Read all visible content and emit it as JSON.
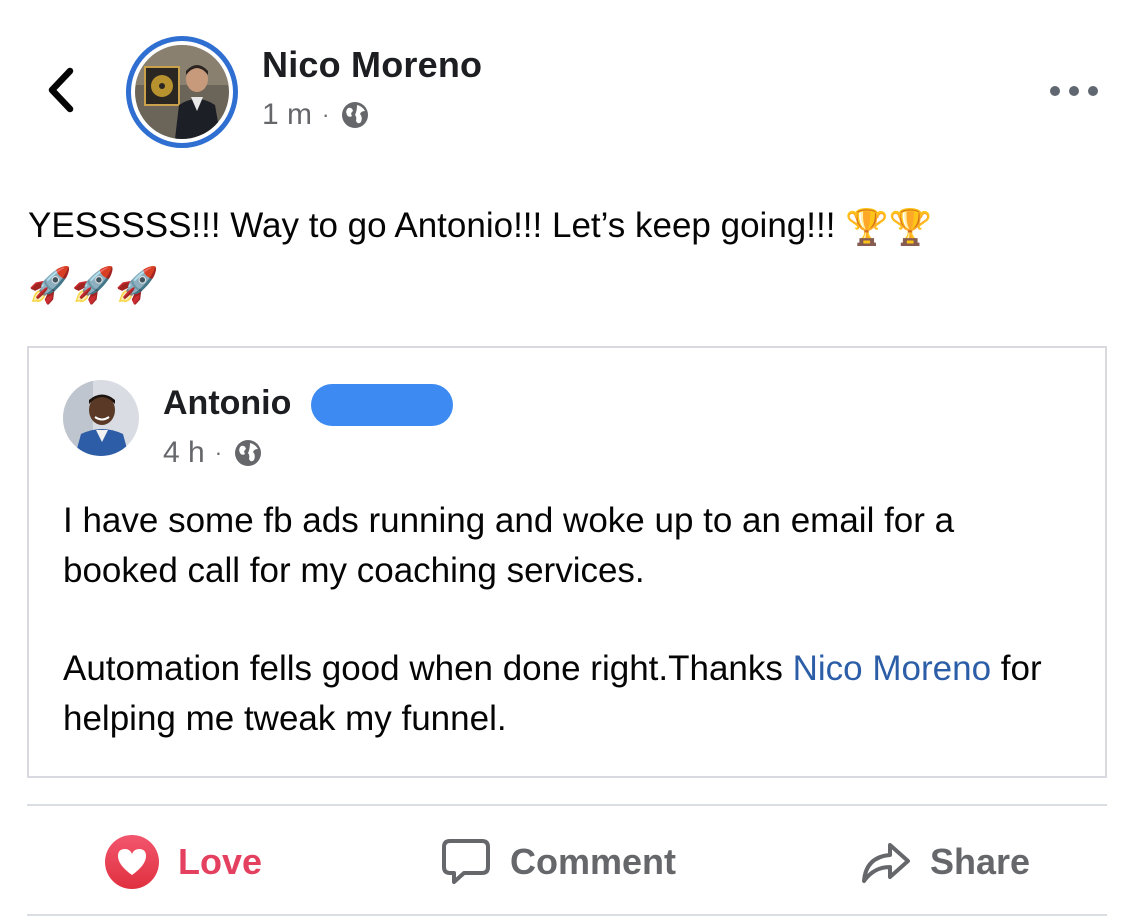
{
  "post": {
    "author": "Nico Moreno",
    "time": "1 m",
    "separator": "·",
    "text": "YESSSSS!!! Way to go Antonio!!! Let’s keep going!!!",
    "emojis_line1": "🏆🏆",
    "emojis_line2": "🚀🚀🚀",
    "privacy_icon": "globe-icon"
  },
  "shared_post": {
    "author": "Antonio",
    "time": "4 h",
    "separator": "·",
    "privacy_icon": "globe-icon",
    "paragraph1": "I have some fb ads running and woke up to an email for a booked call for my coaching services.",
    "paragraph2_prefix": "Automation fells good when done right.Thanks ",
    "mention": "Nico Moreno",
    "paragraph2_suffix": " for helping me tweak my funnel."
  },
  "actions": {
    "love": "Love",
    "comment": "Comment",
    "share": "Share"
  },
  "colors": {
    "accent_blue": "#2f6fd1",
    "mention_blue": "#2c5ea8",
    "love_red": "#e4405f",
    "secondary_text": "#65676b",
    "redaction": "#3d8bf2"
  }
}
